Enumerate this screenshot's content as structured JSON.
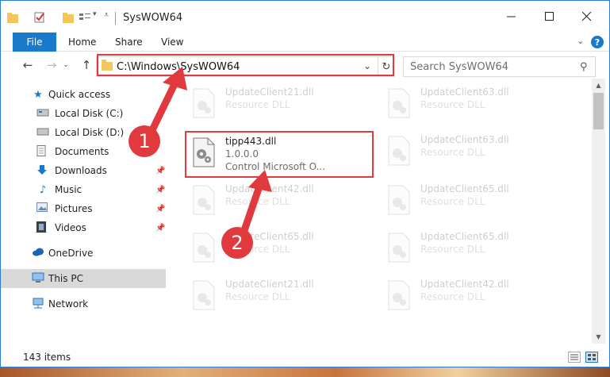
{
  "window": {
    "title": "SysWOW64"
  },
  "ribbon": {
    "file_label": "File",
    "tabs": [
      "Home",
      "Share",
      "View"
    ],
    "help_label": "?"
  },
  "address": {
    "path": "C:\\Windows\\SysWOW64"
  },
  "search": {
    "placeholder": "Search SysWOW64"
  },
  "sidebar": {
    "items": [
      {
        "label": "Quick access",
        "icon": "star-icon"
      },
      {
        "label": "Local Disk (C:)",
        "icon": "drive-icon"
      },
      {
        "label": "Local Disk (D:)",
        "icon": "drive-icon"
      },
      {
        "label": "Documents",
        "icon": "documents-icon"
      },
      {
        "label": "Downloads",
        "icon": "downloads-icon"
      },
      {
        "label": "Music",
        "icon": "music-icon"
      },
      {
        "label": "Pictures",
        "icon": "pictures-icon"
      },
      {
        "label": "Videos",
        "icon": "videos-icon"
      },
      {
        "label": "OneDrive",
        "icon": "cloud-icon"
      },
      {
        "label": "This PC",
        "icon": "computer-icon"
      },
      {
        "label": "Network",
        "icon": "network-icon"
      }
    ]
  },
  "files": {
    "highlighted": {
      "name": "tipp443.dll",
      "version": "1.0.0.0",
      "description": "Control Microsoft O..."
    },
    "faded": [
      {
        "name": "UpdateClient21.dll",
        "type": "Resource DLL"
      },
      {
        "name": "UpdateClient63.dll",
        "type": "Resource DLL"
      },
      {
        "name": "UpdateClient63.dll",
        "type": "Resource DLL"
      },
      {
        "name": "UpdateClient42.dll",
        "type": "Resource DLL"
      },
      {
        "name": "UpdateClient65.dll",
        "type": "Resource DLL"
      },
      {
        "name": "UpdateClient65.dll",
        "type": "Resource DLL"
      },
      {
        "name": "UpdateClient65.dll",
        "type": "Resource DLL"
      },
      {
        "name": "UpdateClient21.dll",
        "type": "Resource DLL"
      },
      {
        "name": "UpdateClient42.dll",
        "type": "Resource DLL"
      }
    ]
  },
  "status": {
    "item_count": "143 items"
  },
  "annotations": {
    "step1": "1",
    "step2": "2"
  },
  "colors": {
    "accent": "#1979ca",
    "highlight": "#e0393e"
  }
}
